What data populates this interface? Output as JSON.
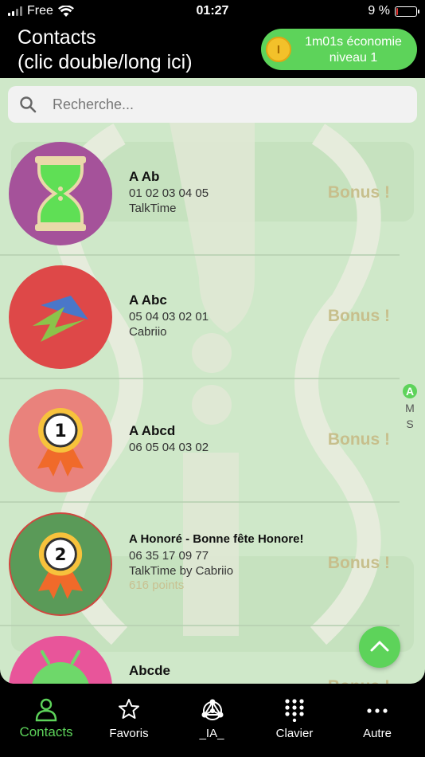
{
  "status_bar": {
    "carrier": "Free",
    "time": "01:27",
    "battery_text": "9 %",
    "battery_level": 0.09
  },
  "header": {
    "title": "Contacts\n(clic double/long ici)",
    "economy_line1": "1m01s économie",
    "economy_line2": "niveau 1",
    "coin_glyph": "I"
  },
  "search": {
    "placeholder": "Recherche..."
  },
  "contacts": [
    {
      "name": "A Ab",
      "line1": "01 02 03 04 05",
      "line2": "TalkTime",
      "points": "",
      "bonus": "Bonus !",
      "avatar": "hourglass-icon"
    },
    {
      "name": "A Abc",
      "line1": "05 04 03 02 01",
      "line2": "Cabriio",
      "points": "",
      "bonus": "Bonus !",
      "avatar": "cabriio-logo-icon"
    },
    {
      "name": "A Abcd",
      "line1": "06 05 04 03 02",
      "line2": "",
      "points": "",
      "bonus": "Bonus !",
      "avatar": "medal-1-icon"
    },
    {
      "name": "A Honoré - Bonne fête Honore!",
      "line1": "06 35 17 09 77",
      "line2": "TalkTime by Cabriio",
      "points": "616 points",
      "bonus": "Bonus !",
      "avatar": "medal-2-icon"
    },
    {
      "name": "Abcde",
      "line1": "",
      "line2": "",
      "points": "",
      "bonus": "Bonus !",
      "avatar": "android-icon"
    }
  ],
  "alpha_index": [
    "A",
    "M",
    "S"
  ],
  "nav": [
    {
      "label": "Contacts",
      "icon": "person-icon",
      "active": true
    },
    {
      "label": "Favoris",
      "icon": "star-icon",
      "active": false
    },
    {
      "label": "_IA_",
      "icon": "ai-network-icon",
      "active": false
    },
    {
      "label": "Clavier",
      "icon": "keypad-icon",
      "active": false
    },
    {
      "label": "Autre",
      "icon": "more-dots-icon",
      "active": false
    }
  ],
  "colors": {
    "accent_green": "#5dd35a",
    "list_background": "#cfe8c9",
    "bonus_text": "#c7bf8c",
    "battery_low": "#e53935"
  }
}
